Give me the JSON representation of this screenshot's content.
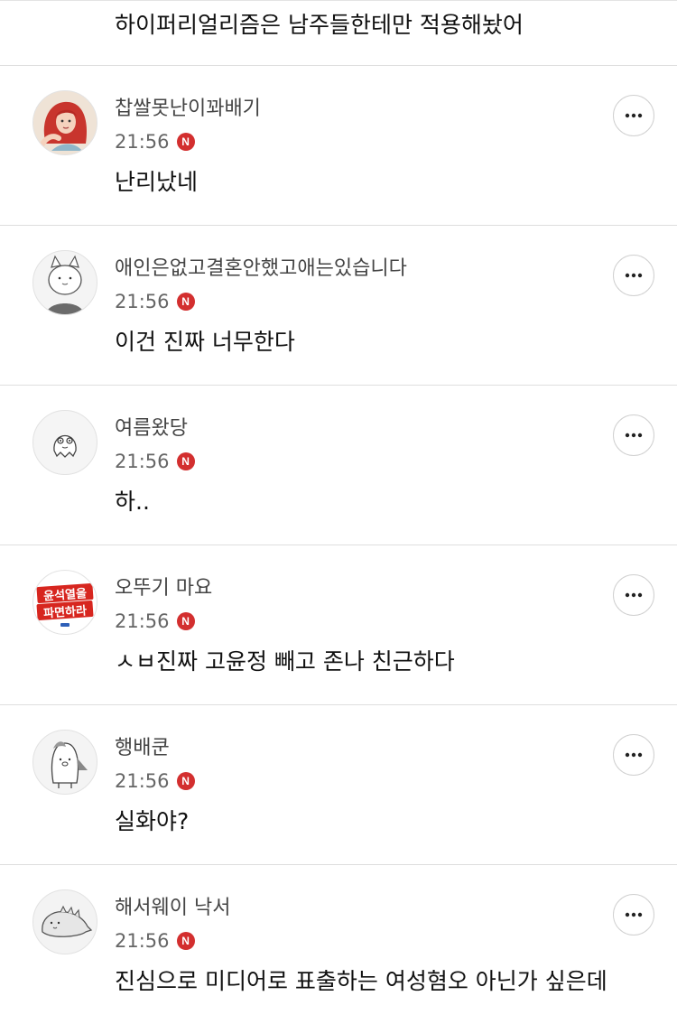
{
  "thread": {
    "previous_comment_tail": "하이퍼리얼리즘은 남주들한테만 적용해놨어"
  },
  "colors": {
    "new_badge": "#d32f2f",
    "divider": "#dedede",
    "nickname": "#444444",
    "time": "#666666"
  },
  "comments": [
    {
      "nickname": "찹쌀못난이꽈배기",
      "time": "21:56",
      "badge": "N",
      "text": "난리났네",
      "avatar_icon": "mermaid-character-icon"
    },
    {
      "nickname": "애인은없고결혼안했고애는있습니다",
      "time": "21:56",
      "badge": "N",
      "text": "이건 진짜 너무한다",
      "avatar_icon": "cat-character-icon"
    },
    {
      "nickname": "여름왔당",
      "time": "21:56",
      "badge": "N",
      "text": "하..",
      "avatar_icon": "ghost-character-icon"
    },
    {
      "nickname": "오뚜기 마요",
      "time": "21:56",
      "badge": "N",
      "text": "ㅅㅂ진짜 고윤정 빼고 존나 친근하다",
      "avatar_icon": "slogan-sticker-icon",
      "avatar_slogan_line1": "윤석열을",
      "avatar_slogan_line2": "파면하라"
    },
    {
      "nickname": "행배쿤",
      "time": "21:56",
      "badge": "N",
      "text": "실화야?",
      "avatar_icon": "penguin-character-icon"
    },
    {
      "nickname": "해서웨이 낙서",
      "time": "21:56",
      "badge": "N",
      "text": "진심으로 미디어로 표출하는 여성혐오 아닌가 싶은데",
      "avatar_icon": "dinosaur-character-icon"
    }
  ]
}
